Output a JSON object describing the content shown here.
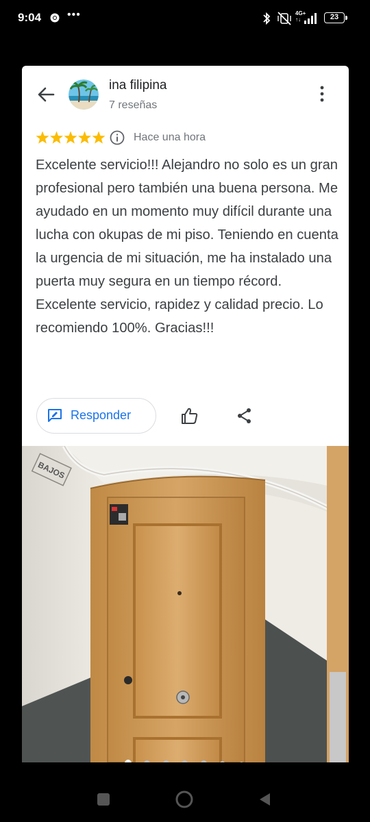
{
  "status_bar": {
    "time": "9:04",
    "overflow_dots": "•••",
    "network_top": "4G+",
    "network_bottom": "↑↓",
    "battery": "23"
  },
  "review": {
    "user_name": "ina filipina",
    "user_sub": "7 reseñas",
    "rating": 5,
    "rating_max": 5,
    "time_ago": "Hace una hora",
    "text": "Excelente servicio!!! Alejandro no solo es un gran profesional pero también una buena persona. Me ayudado en un momento muy difícil durante una lucha con okupas de mi piso. Teniendo en cuenta la urgencia de mi situación, me ha instalado una puerta muy segura en un tiempo récord. Excelente servicio, rapidez y calidad precio. Lo recomiendo 100%. Gracias!!!",
    "reply_label": "Responder",
    "photo_sign_text": "BAJOS",
    "photo_count": 7,
    "photo_active_index": 0
  },
  "colors": {
    "star": "#fbbc04",
    "accent": "#1a73e8",
    "text": "#3c4043",
    "secondary": "#70757a"
  },
  "icons": {
    "back": "arrow-left-icon",
    "more": "more-vert-icon",
    "info": "info-icon",
    "reply": "reply-icon",
    "like": "thumb-up-icon",
    "share": "share-icon"
  }
}
